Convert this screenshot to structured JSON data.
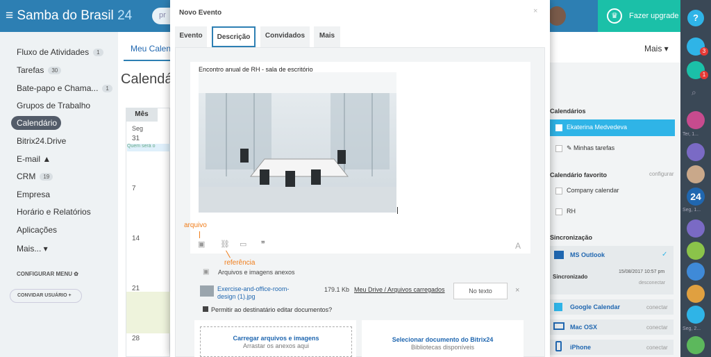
{
  "header": {
    "brand": "Samba do Brasil",
    "brand_num": "24",
    "search_stub": "pr",
    "upgrade_label": "Fazer upgrade",
    "help_label": "?"
  },
  "sidebar": {
    "items": [
      {
        "label": "Fluxo de Atividades",
        "count": "1"
      },
      {
        "label": "Tarefas",
        "count": "30"
      },
      {
        "label": "Bate-papo e Chama...",
        "count": "1"
      },
      {
        "label": "Grupos de Trabalho"
      },
      {
        "label": "Calendário"
      },
      {
        "label": "Bitrix24.Drive"
      },
      {
        "label": "E-mail ▲"
      },
      {
        "label": "CRM",
        "count": "19"
      },
      {
        "label": "Empresa"
      },
      {
        "label": "Horário e Relatórios"
      },
      {
        "label": "Aplicações"
      },
      {
        "label": "Mais... ▾"
      }
    ],
    "configure_menu": "CONFIGURAR MENU ✿",
    "invite_users": "CONVIDAR USUÁRIO +"
  },
  "main": {
    "tab": "Meu Calen",
    "title": "Calendár",
    "view_button": "Mês",
    "day_header": "Seg",
    "days": [
      "31",
      "7",
      "14",
      "21",
      "28"
    ],
    "event_chip": "Quem será o",
    "more": "Mais ▾"
  },
  "right_panel": {
    "calendars_title": "Calendários",
    "cal_items": [
      "Ekaterina Medvedeva",
      "✎ Minhas tarefas"
    ],
    "favorites_title": "Calendário favorito",
    "configure": "configurar",
    "fav_items": [
      "Company calendar",
      "RH"
    ],
    "sync_title": "Sincronização",
    "outlook": "MS Outlook",
    "synced": "Sincronizado",
    "synced_time": "15/08/2017 10:57 pm",
    "disconnect": "desconectar",
    "google": "Google Calendar",
    "mac": "Mac OSX",
    "iphone": "iPhone",
    "connect": "conectar"
  },
  "right_bar": {
    "badge1": "3",
    "badge2": "1",
    "label1": "Ter, 1...",
    "num": "24",
    "label2": "Seg, 1...",
    "label3": "Seg, 2..."
  },
  "modal": {
    "title": "Novo Evento",
    "close": "×",
    "tabs": [
      "Evento",
      "Descrição",
      "Convidados",
      "Mais"
    ],
    "editor_text": "Encontro anual de RH - sala de escritório",
    "tool_A": "A",
    "annotation_file": "arquivo",
    "annotation_ref": "referência",
    "files_label": "Arquivos e imagens anexos",
    "file_name": "Exercise-and-office-room-design (1).jpg",
    "file_size": "179.1 Kb",
    "file_location": "Meu Drive / Arquivos carregados",
    "no_text": "No texto",
    "file_remove": "×",
    "permission": "Permitir ao destinatário editar documentos?",
    "upload_title": "Carregar arquivos e imagens",
    "upload_sub": "Arrastar os anexos aqui",
    "bitrix_title": "Selecionar documento do Bitrix24",
    "bitrix_sub": "Bibliotecas disponíveis"
  },
  "colors": {
    "topbar": "#2d7fb3",
    "upgrade": "#1bc0a8",
    "accent": "#2fb4e7",
    "annotation": "#f07d1a"
  }
}
